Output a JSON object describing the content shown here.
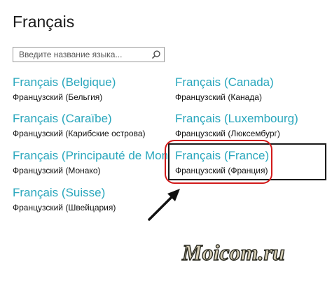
{
  "header": {
    "title": "Français"
  },
  "search": {
    "placeholder": "Введите название языка..."
  },
  "languages": [
    {
      "name": "Français (Belgique)",
      "native": "Французский (Бельгия)"
    },
    {
      "name": "Français (Canada)",
      "native": "Французский (Канада)"
    },
    {
      "name": "Français (Caraïbe)",
      "native": "Французский (Карибские острова)"
    },
    {
      "name": "Français (Luxembourg)",
      "native": "Французский (Люксембург)"
    },
    {
      "name": "Français (Principauté de Monaco)",
      "native": "Французский (Монако)"
    },
    {
      "name": "Français (France)",
      "native": "Французский (Франция)"
    },
    {
      "name": "Français (Suisse)",
      "native": "Французский (Швейцария)"
    }
  ],
  "selected_language": "Français (France)",
  "watermark": {
    "text": "Moicom.ru"
  },
  "colors": {
    "accent": "#2aa7bd",
    "highlight_oval": "#d21a1a",
    "selection_border": "#1a1a1a"
  },
  "icons": {
    "search": "search-icon",
    "pointer": "arrow-icon"
  }
}
